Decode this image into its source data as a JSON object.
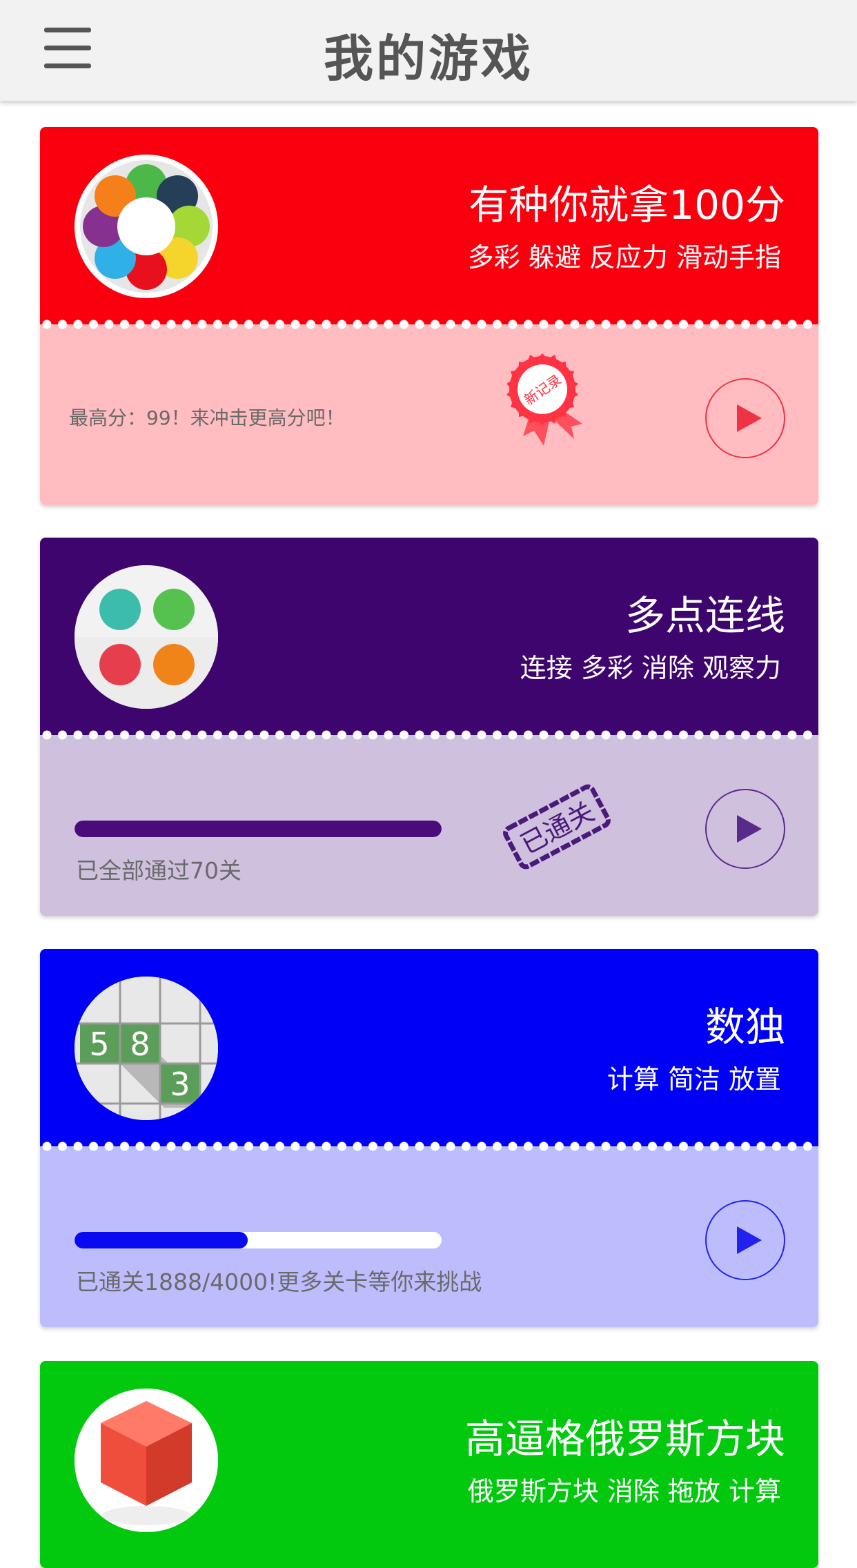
{
  "header": {
    "title": "我的游戏",
    "menu_icon": "hamburger-menu-icon"
  },
  "games": [
    {
      "title": "有种你就拿100分",
      "tags": "多彩  躲避  反应力   滑动手指",
      "status_text": "最高分：99！来冲击更高分吧！",
      "badge": "新记录",
      "colors": {
        "top": "#fa000f",
        "bottom": "#ffbdc1",
        "accent": "#ee3344"
      }
    },
    {
      "title": "多点连线",
      "tags": "连接  多彩  消除  观察力",
      "status_text": "已全部通过70关",
      "progress": 1.0,
      "stamp": "已通关",
      "colors": {
        "top": "#3f056f",
        "bottom": "#cfc0de",
        "accent": "#4a1280"
      }
    },
    {
      "title": "数独",
      "tags": "计算  简洁  放置",
      "status_text": "已通关1888/4000!更多关卡等你来挑战",
      "progress": 0.472,
      "grid_digits": [
        "5",
        "8",
        "3"
      ],
      "colors": {
        "top": "#0000f7",
        "bottom": "#bdbdfd",
        "accent": "#2222ee"
      }
    },
    {
      "title": "高逼格俄罗斯方块",
      "tags": "俄罗斯方块  消除  拖放  计算",
      "colors": {
        "top": "#02c80e",
        "accent": "#f04e3c"
      }
    }
  ]
}
